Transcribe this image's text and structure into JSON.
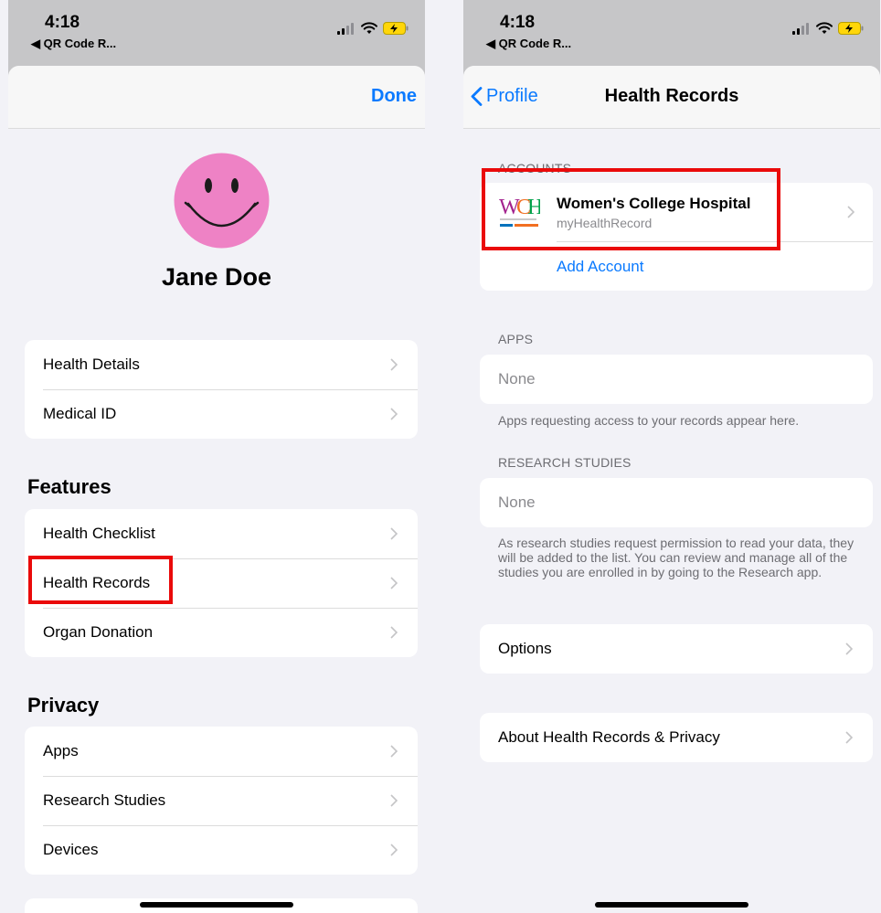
{
  "status": {
    "time": "4:18",
    "back_app": "◀ QR Code R..."
  },
  "left": {
    "done_label": "Done",
    "profile_name": "Jane Doe",
    "group1": [
      "Health Details",
      "Medical ID"
    ],
    "features_title": "Features",
    "features": [
      "Health Checklist",
      "Health Records",
      "Organ Donation"
    ],
    "privacy_title": "Privacy",
    "privacy": [
      "Apps",
      "Research Studies",
      "Devices"
    ]
  },
  "right": {
    "back_label": "Profile",
    "title": "Health Records",
    "accounts_header": "ACCOUNTS",
    "account": {
      "name": "Women's College Hospital",
      "subtitle": "myHealthRecord",
      "logo_text": "WCH"
    },
    "add_account": "Add Account",
    "apps_header": "APPS",
    "apps_value": "None",
    "apps_footnote": "Apps requesting access to your records appear here.",
    "research_header": "RESEARCH STUDIES",
    "research_value": "None",
    "research_footnote": "As research studies request permission to read your data, they will be added to the list. You can review and manage all of the studies you are enrolled in by going to the Research app.",
    "options_label": "Options",
    "about_label": "About Health Records & Privacy"
  },
  "colors": {
    "accent": "#0a7aff",
    "highlight": "#ea0a0a",
    "avatar": "#ee82c5",
    "battery": "#ffd60a"
  },
  "icons": [
    "signal-icon",
    "wifi-icon",
    "battery-charging-icon",
    "chevron-right-icon",
    "chevron-left-icon",
    "smiley-avatar-icon"
  ]
}
